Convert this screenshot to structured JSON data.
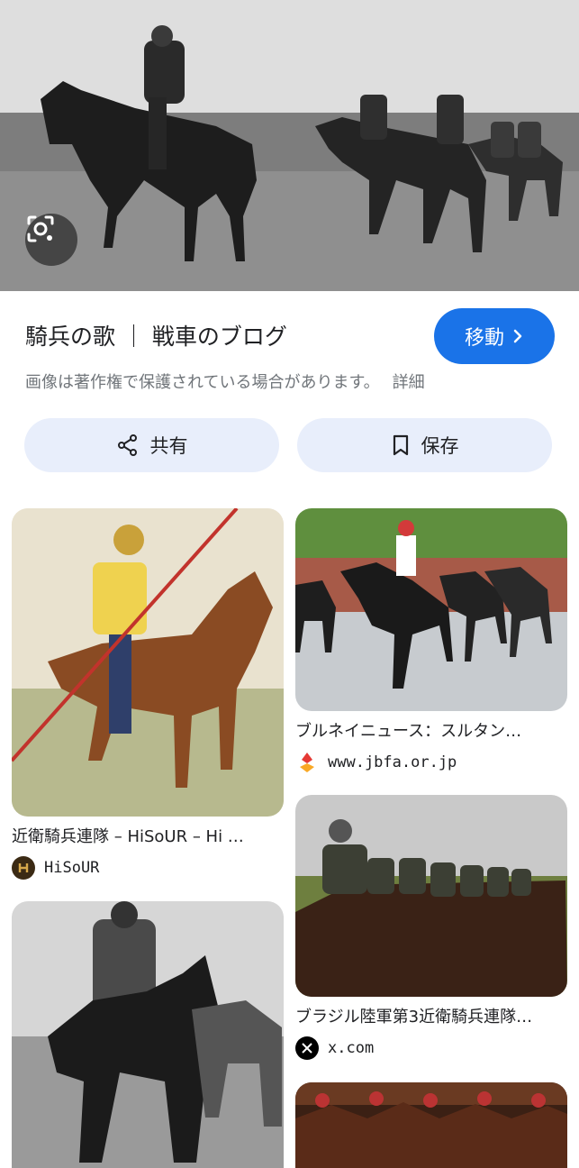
{
  "header": {
    "title": "騎兵の歌 ｜ 戦車のブログ",
    "goto_label": "移動",
    "copyright_notice": "画像は著作権で保護されている場合があります。",
    "details_link": "詳細"
  },
  "actions": {
    "share_label": "共有",
    "save_label": "保存"
  },
  "related": [
    {
      "caption": "近衛騎兵連隊 – HiSoUR – Hi …",
      "source": "HiSoUR"
    },
    {
      "caption": "ブルネイニュース：スルタン…",
      "source": "www.jbfa.or.jp"
    },
    {
      "caption": "ブラジル陸軍第3近衛騎兵連隊…",
      "source": "x.com"
    },
    {
      "caption": "",
      "source": ""
    },
    {
      "caption": "",
      "source": ""
    }
  ],
  "colors": {
    "accent": "#1a73e8",
    "button_bg": "#e8eefb"
  }
}
